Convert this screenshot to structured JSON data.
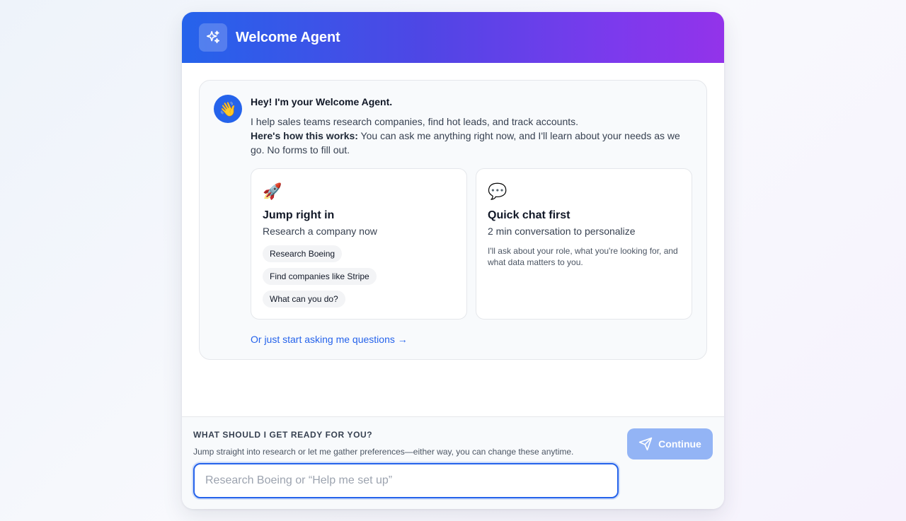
{
  "header": {
    "title": "Welcome Agent",
    "icon": "sparkles-icon"
  },
  "message": {
    "avatar": "👋",
    "greeting": "Hey! I'm your Welcome Agent.",
    "intro": "I help sales teams research companies, find hot leads, and track accounts.",
    "how_label": "Here's how this works:",
    "how_text": " You can ask me anything right now, and I'll learn about your needs as we go. No forms to fill out.",
    "options": [
      {
        "emoji": "🚀",
        "title": "Jump right in",
        "subtitle": "Research a company now",
        "chips": [
          "Research Boeing",
          "Find companies like Stripe",
          "What can you do?"
        ]
      },
      {
        "emoji": "💬",
        "title": "Quick chat first",
        "subtitle": "2 min conversation to personalize",
        "description": "I'll ask about your role, what you're looking for, and what data matters to you."
      }
    ],
    "link": "Or just start asking me questions →"
  },
  "footer": {
    "heading": "WHAT SHOULD I GET READY FOR YOU?",
    "subtext": "Jump straight into research or let me gather preferences—either way, you can change these anytime.",
    "input_placeholder": "Research Boeing or “Help me set up”",
    "continue_label": "Continue"
  },
  "colors": {
    "accent": "#2563eb",
    "gradient_start": "#2563eb",
    "gradient_end": "#9333ea",
    "continue_bg": "#93b4f5"
  }
}
